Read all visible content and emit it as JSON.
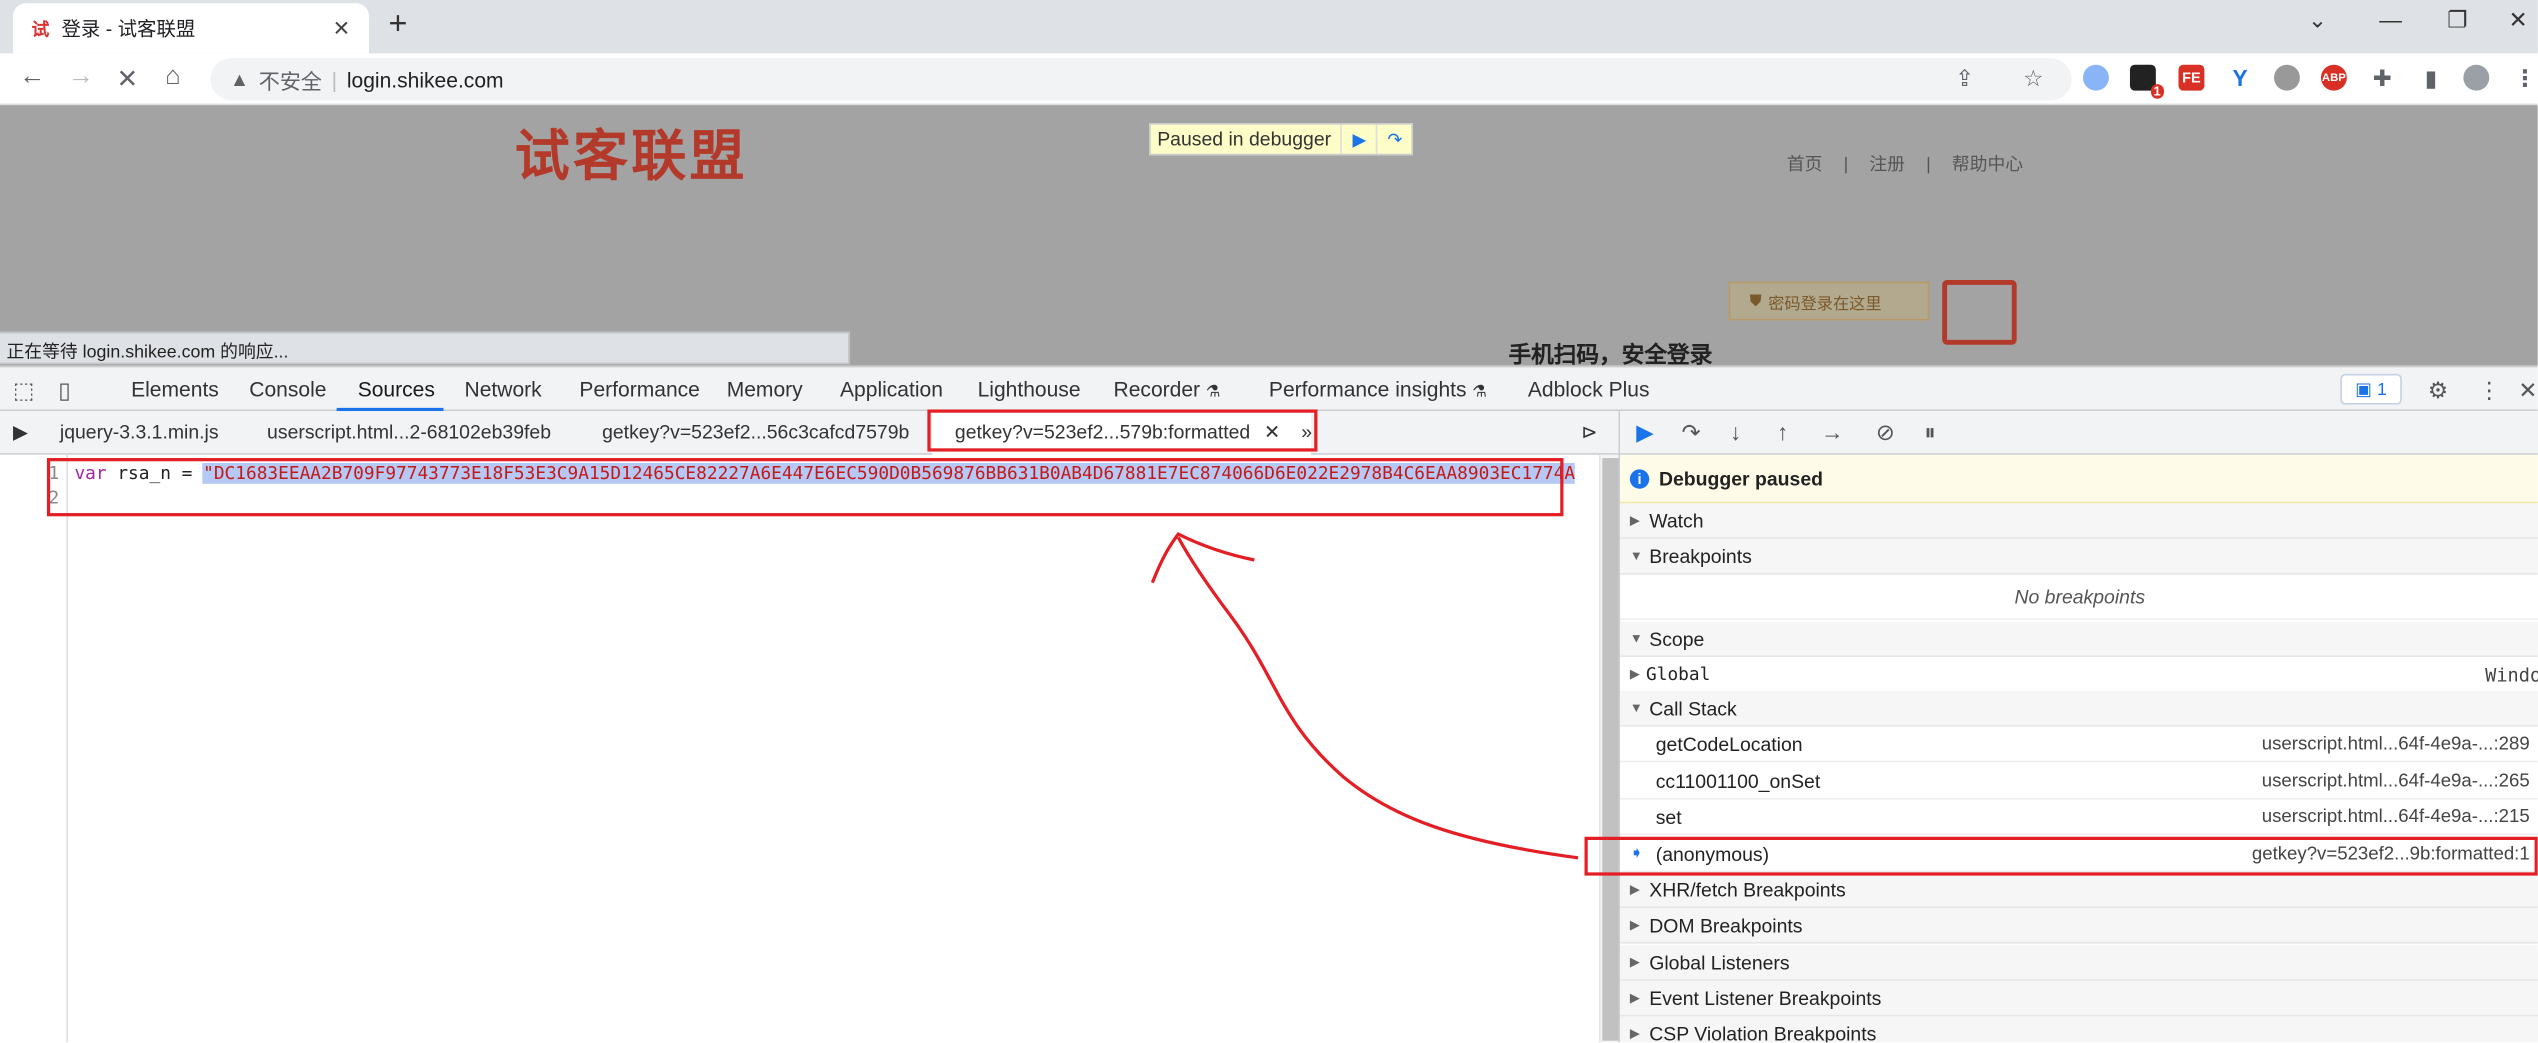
{
  "browser": {
    "tab_title": "登录 - 试客联盟",
    "tab_favicon": "试",
    "url_insecure_label": "不安全",
    "url": "login.shikee.com",
    "extension_badge": "1",
    "extensions": [
      "FE",
      "ABP"
    ]
  },
  "page": {
    "logo": "试客联盟",
    "paused_label": "Paused in debugger",
    "nav": [
      "首页",
      "|",
      "注册",
      "|",
      "帮助中心"
    ],
    "password_login": "密码登录在这里",
    "scan_text": "手机扫码，安全登录",
    "status": "正在等待 login.shikee.com 的响应..."
  },
  "devtools": {
    "panels": [
      "Elements",
      "Console",
      "Sources",
      "Network",
      "Performance",
      "Memory",
      "Application",
      "Lighthouse",
      "Recorder",
      "Performance insights",
      "Adblock Plus"
    ],
    "active_panel": "Sources",
    "issues_count": "1",
    "source_tabs": [
      "jquery-3.3.1.min.js",
      "userscript.html...2-68102eb39feb",
      "getkey?v=523ef2...56c3cafcd7579b",
      "getkey?v=523ef2...579b:formatted"
    ],
    "code": {
      "line_numbers": [
        "1",
        "2"
      ],
      "keyword": "var",
      "identifier": " rsa_n = ",
      "string": "\"DC1683EEAA2B709F97743773E18F53E3C9A15D12465CE82227A6E447E6EC590D0B569876BB631B0AB4D67881E7EC874066D6E022E2978B4C6EAA8903EC1774A"
    },
    "debugger": {
      "paused_message": "Debugger paused",
      "sections": {
        "watch": "Watch",
        "breakpoints": "Breakpoints",
        "no_breakpoints": "No breakpoints",
        "scope": "Scope",
        "global": "Global",
        "global_value": "Window",
        "call_stack": "Call Stack",
        "xhr": "XHR/fetch Breakpoints",
        "dom": "DOM Breakpoints",
        "global_listeners": "Global Listeners",
        "event_listener": "Event Listener Breakpoints",
        "csp": "CSP Violation Breakpoints"
      },
      "call_stack": [
        {
          "fn": "getCodeLocation",
          "loc": "userscript.html...64f-4e9a-...:289"
        },
        {
          "fn": "cc11001100_onSet",
          "loc": "userscript.html...64f-4e9a-...:265"
        },
        {
          "fn": "set",
          "loc": "userscript.html...64f-4e9a-...:215"
        },
        {
          "fn": "(anonymous)",
          "loc": "getkey?v=523ef2...9b:formatted:1"
        }
      ]
    }
  },
  "colors": {
    "annotation": "#e31e24",
    "accent": "#1a73e8",
    "logo": "#b3392a"
  }
}
